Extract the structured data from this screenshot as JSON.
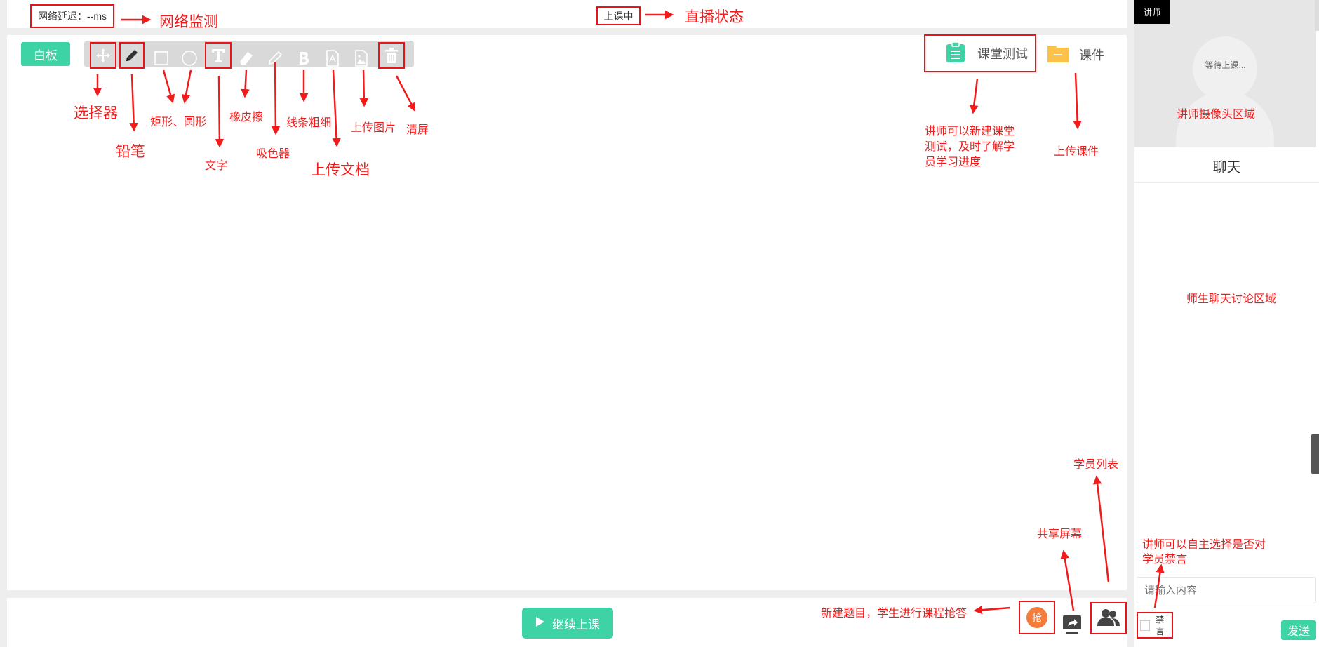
{
  "header": {
    "network_latency": "网络延迟：--ms",
    "live_status": "上课中"
  },
  "toolbar": {
    "whiteboard_label": "白板"
  },
  "right_actions": {
    "class_test_label": "课堂测试",
    "courseware_label": "课件"
  },
  "sidebar": {
    "teacher_tag": "讲师",
    "waiting_text": "等待上课...",
    "chat_title": "聊天",
    "chat_placeholder": "请输入内容",
    "mute_label": "禁言",
    "send_label": "发送"
  },
  "bottom": {
    "continue_label": "继续上课",
    "grab_label": "抢"
  },
  "annotations": {
    "network_monitor": "网络监测",
    "live_state": "直播状态",
    "selector": "选择器",
    "pencil": "铅笔",
    "shapes": "矩形、圆形",
    "text": "文字",
    "eraser": "橡皮擦",
    "color_picker": "吸色器",
    "line_width": "线条粗细",
    "upload_doc": "上传文档",
    "upload_image": "上传图片",
    "clear_screen": "清屏",
    "class_test_desc": "讲师可以新建课堂测试，及时了解学员学习进度",
    "upload_courseware": "上传课件",
    "camera_area": "讲师摄像头区域",
    "chat_area": "师生聊天讨论区域",
    "student_list": "学员列表",
    "share_screen": "共享屏幕",
    "new_question": "新建题目，学生进行课程抢答",
    "mute_desc": "讲师可以自主选择是否对学员禁言"
  },
  "colors": {
    "accent_green": "#3dd3a4",
    "annotation_red": "#f21a1a",
    "grab_orange": "#f47c3c",
    "folder_yellow": "#fbc149"
  }
}
